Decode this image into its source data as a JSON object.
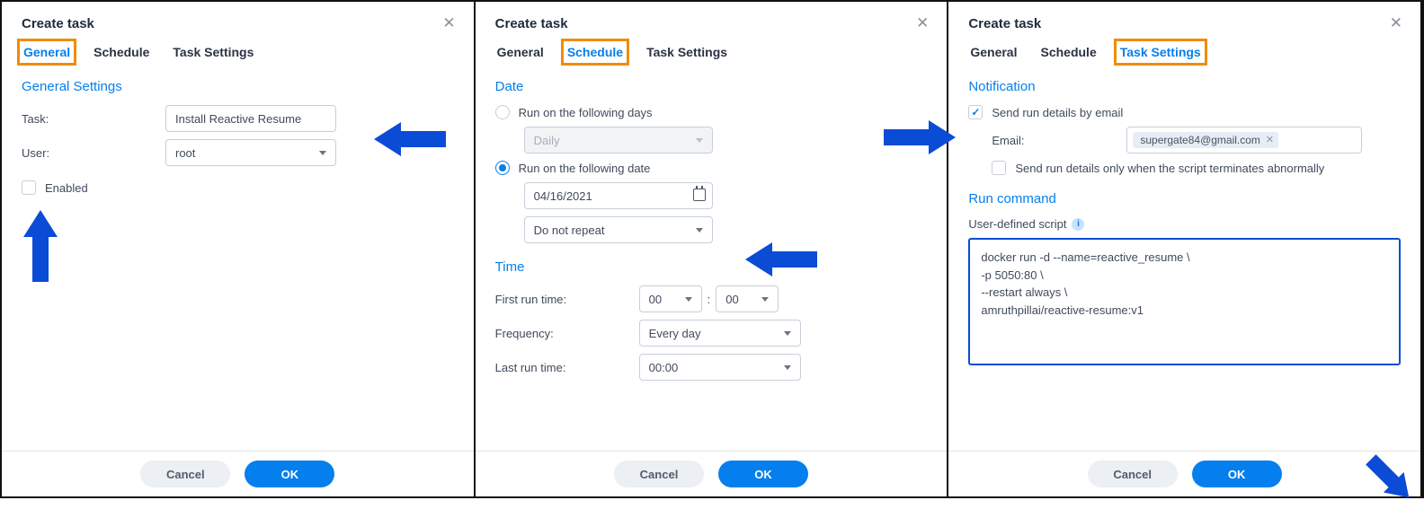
{
  "dialogs": {
    "title": "Create task",
    "tabs": {
      "general": "General",
      "schedule": "Schedule",
      "taskSettings": "Task Settings"
    },
    "buttons": {
      "cancel": "Cancel",
      "ok": "OK"
    }
  },
  "panel1": {
    "section": "General Settings",
    "taskLabel": "Task:",
    "taskValue": "Install Reactive Resume",
    "userLabel": "User:",
    "userValue": "root",
    "enabledLabel": "Enabled"
  },
  "panel2": {
    "dateSection": "Date",
    "opt1": "Run on the following days",
    "dailyValue": "Daily",
    "opt2": "Run on the following date",
    "dateValue": "04/16/2021",
    "repeatValue": "Do not repeat",
    "timeSection": "Time",
    "firstRunLabel": "First run time:",
    "firstHour": "00",
    "firstMin": "00",
    "timeColon": ":",
    "freqLabel": "Frequency:",
    "freqValue": "Every day",
    "lastRunLabel": "Last run time:",
    "lastRunValue": "00:00"
  },
  "panel3": {
    "notifSection": "Notification",
    "sendEmailLabel": "Send run details by email",
    "emailLabel": "Email:",
    "emailValue": "supergate84@gmail.com",
    "abnormalLabel": "Send run details only when the script terminates abnormally",
    "runCmdSection": "Run command",
    "userScriptLabel": "User-defined script",
    "script": "docker run -d --name=reactive_resume \\\n-p 5050:80 \\\n--restart always \\\namruthpillai/reactive-resume:v1"
  }
}
